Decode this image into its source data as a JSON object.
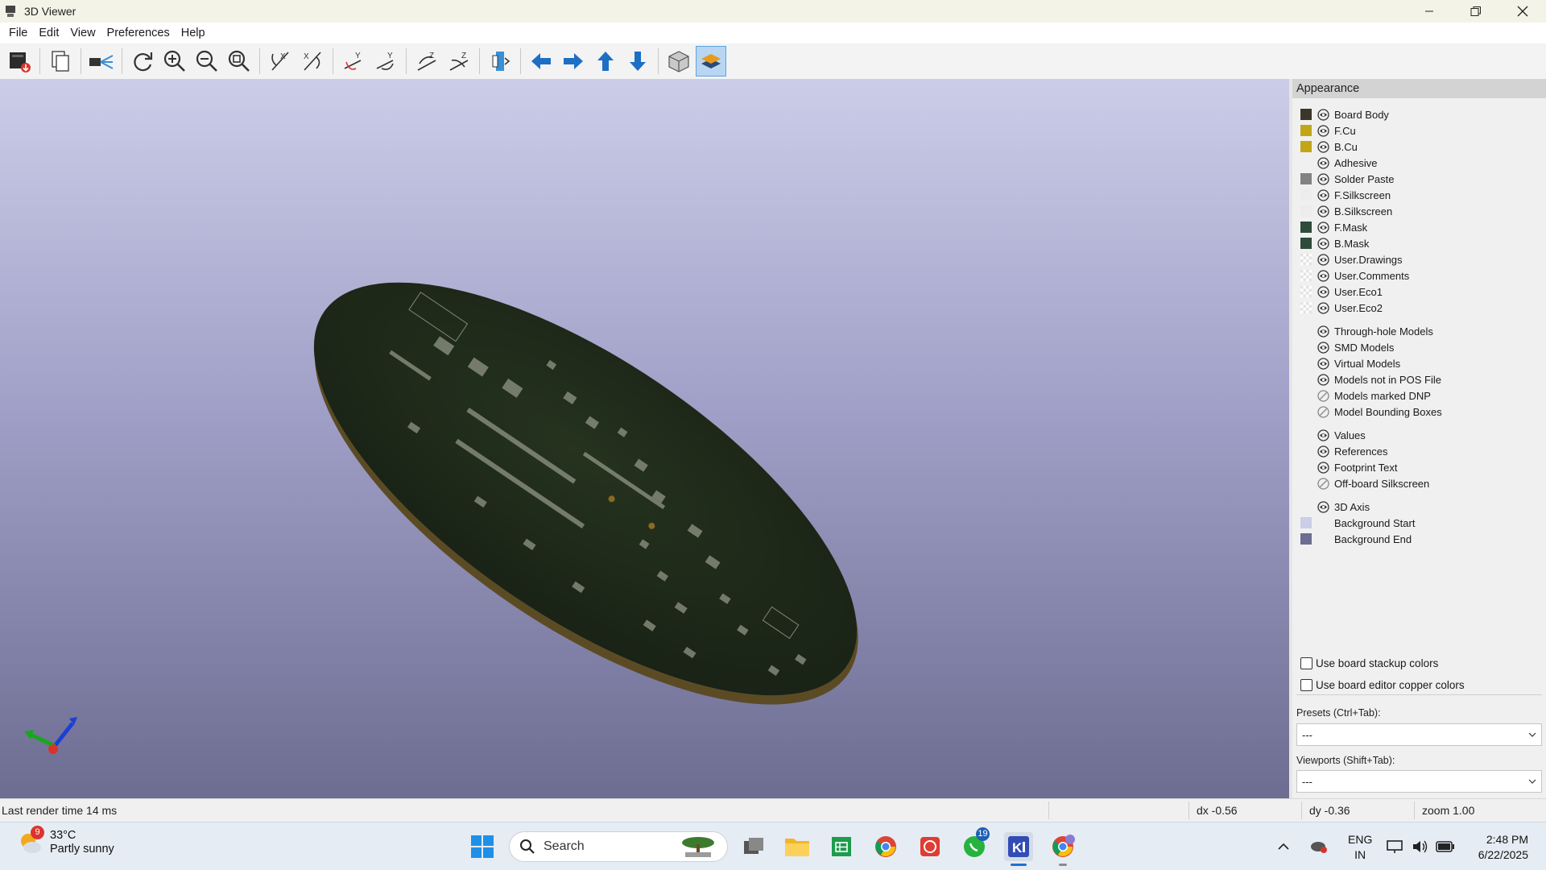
{
  "window": {
    "title": "3D Viewer",
    "icon": "kicad-3d-viewer-icon"
  },
  "menu": [
    "File",
    "Edit",
    "View",
    "Preferences",
    "Help"
  ],
  "toolbar": {
    "buttons": [
      "export-image-icon",
      "copy-image-icon",
      "raytracing-icon",
      "reload-icon",
      "zoom-in-icon",
      "zoom-out-icon",
      "zoom-fit-icon",
      "rotate-x-cw-icon",
      "rotate-x-ccw-icon",
      "rotate-y-cw-icon",
      "rotate-y-ccw-icon",
      "rotate-z-cw-icon",
      "rotate-z-ccw-icon",
      "flip-board-icon",
      "pan-left-icon",
      "pan-right-icon",
      "pan-up-icon",
      "pan-down-icon",
      "orthographic-icon",
      "layers-manager-icon"
    ]
  },
  "appearance": {
    "title": "Appearance",
    "layers": [
      {
        "label": "Board Body",
        "color": "#3b3728",
        "swatch": "solid"
      },
      {
        "label": "F.Cu",
        "color": "#c2a617",
        "swatch": "solid"
      },
      {
        "label": "B.Cu",
        "color": "#c2a617",
        "swatch": "solid"
      },
      {
        "label": "Adhesive",
        "color": "",
        "swatch": "none"
      },
      {
        "label": "Solder Paste",
        "color": "#828282",
        "swatch": "solid"
      },
      {
        "label": "F.Silkscreen",
        "color": "#ececec",
        "swatch": "solid"
      },
      {
        "label": "B.Silkscreen",
        "color": "#ececec",
        "swatch": "solid"
      },
      {
        "label": "F.Mask",
        "color": "#2f4b3b",
        "swatch": "solid"
      },
      {
        "label": "B.Mask",
        "color": "#2f4b3b",
        "swatch": "solid"
      },
      {
        "label": "User.Drawings",
        "color": "",
        "swatch": "checker"
      },
      {
        "label": "User.Comments",
        "color": "",
        "swatch": "checker"
      },
      {
        "label": "User.Eco1",
        "color": "",
        "swatch": "checker"
      },
      {
        "label": "User.Eco2",
        "color": "",
        "swatch": "checker"
      }
    ],
    "models": [
      {
        "label": "Through-hole Models",
        "visible": true
      },
      {
        "label": "SMD Models",
        "visible": true
      },
      {
        "label": "Virtual Models",
        "visible": true
      },
      {
        "label": "Models not in POS File",
        "visible": true
      },
      {
        "label": "Models marked DNP",
        "visible": false
      },
      {
        "label": "Model Bounding Boxes",
        "visible": false
      }
    ],
    "texts": [
      {
        "label": "Values",
        "visible": true
      },
      {
        "label": "References",
        "visible": true
      },
      {
        "label": "Footprint Text",
        "visible": true
      },
      {
        "label": "Off-board Silkscreen",
        "visible": false
      }
    ],
    "misc": [
      {
        "label": "3D Axis",
        "visible": true,
        "swatch": "none",
        "color": ""
      },
      {
        "label": "Background Start",
        "visible": null,
        "swatch": "solid",
        "color": "#cccde8"
      },
      {
        "label": "Background End",
        "visible": null,
        "swatch": "solid",
        "color": "#6d6d92"
      }
    ],
    "use_stackup_colors": "Use board stackup colors",
    "use_editor_copper_colors": "Use board editor copper colors",
    "presets_label": "Presets (Ctrl+Tab):",
    "presets_value": "---",
    "viewports_label": "Viewports (Shift+Tab):",
    "viewports_value": "---"
  },
  "status": {
    "render_time": "Last render time 14 ms",
    "dx": "dx -0.56",
    "dy": "dy -0.36",
    "zoom": "zoom 1.00"
  },
  "taskbar": {
    "weather_temp": "33°C",
    "weather_desc": "Partly sunny",
    "weather_badge": "9",
    "search_placeholder": "Search",
    "whatsapp_badge": "19",
    "lang_top": "ENG",
    "lang_bottom": "IN",
    "time": "2:48 PM",
    "date": "6/22/2025"
  },
  "colors": {
    "accent": "#5da3e0",
    "board_mask": "#1f2a1c",
    "board_edge": "#5b4b25"
  }
}
